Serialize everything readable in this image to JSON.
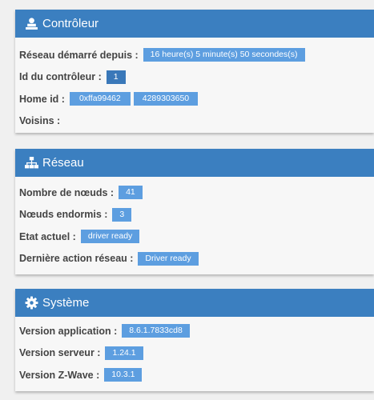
{
  "colors": {
    "header": "#3b7fc0",
    "badge": "#5d9ee0",
    "badge_dark": "#3a78b9"
  },
  "controller": {
    "icon": "controller-icon",
    "title": "Contrôleur",
    "rows": {
      "network_started": {
        "label": "Réseau démarré depuis :",
        "value": "16 heure(s) 5 minute(s) 50 secondes(s)"
      },
      "controller_id": {
        "label": "Id du contrôleur :",
        "value": "1"
      },
      "home_id": {
        "label": "Home id :",
        "hex": "0xffa99462",
        "dec": "4289303650"
      },
      "neighbors": {
        "label": "Voisins :"
      }
    }
  },
  "network": {
    "icon": "sitemap-icon",
    "title": "Réseau",
    "rows": {
      "node_count": {
        "label": "Nombre de nœuds :",
        "value": "41"
      },
      "sleeping_nodes": {
        "label": "Nœuds endormis :",
        "value": "3"
      },
      "current_state": {
        "label": "Etat actuel :",
        "value": "driver ready"
      },
      "last_action": {
        "label": "Dernière action réseau :",
        "value": "Driver ready"
      }
    }
  },
  "system": {
    "icon": "gear-icon",
    "title": "Système",
    "rows": {
      "app_version": {
        "label": "Version application :",
        "value": "8.6.1.7833cd8"
      },
      "server_version": {
        "label": "Version serveur :",
        "value": "1.24.1"
      },
      "zwave_version": {
        "label": "Version Z-Wave :",
        "value": "10.3.1"
      }
    }
  }
}
